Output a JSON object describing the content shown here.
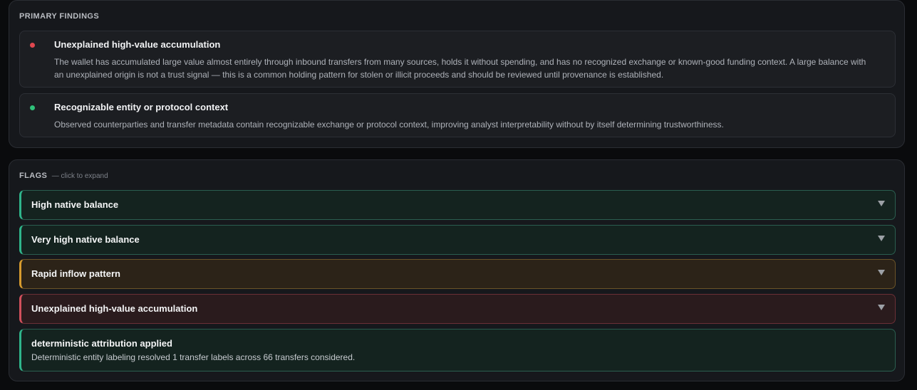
{
  "primary_findings": {
    "title": "PRIMARY FINDINGS",
    "items": [
      {
        "status_color": "#e0474f",
        "title": "Unexplained high-value accumulation",
        "description": "The wallet has accumulated large value almost entirely through inbound transfers from many sources, holds it without spending, and has no recognized exchange or known-good funding context. A large balance with an unexplained origin is not a trust signal — this is a common holding pattern for stolen or illicit proceeds and should be reviewed until provenance is established."
      },
      {
        "status_color": "#2fc27a",
        "title": "Recognizable entity or protocol context",
        "description": "Observed counterparties and transfer metadata contain recognizable exchange or protocol context, improving analyst interpretability without by itself determining trustworthiness."
      }
    ]
  },
  "flags": {
    "title": "FLAGS",
    "hint": "— click to expand",
    "items": [
      {
        "label": "High native balance",
        "severity": "teal"
      },
      {
        "label": "Very high native balance",
        "severity": "teal"
      },
      {
        "label": "Rapid inflow pattern",
        "severity": "amber"
      },
      {
        "label": "Unexplained high-value accumulation",
        "severity": "red"
      }
    ],
    "info": {
      "label": "deterministic attribution applied",
      "description": "Deterministic entity labeling resolved 1 transfer labels across 66 transfers considered."
    }
  },
  "colors": {
    "teal": "#2fb58b",
    "amber": "#d79b2e",
    "red": "#d1505c"
  }
}
